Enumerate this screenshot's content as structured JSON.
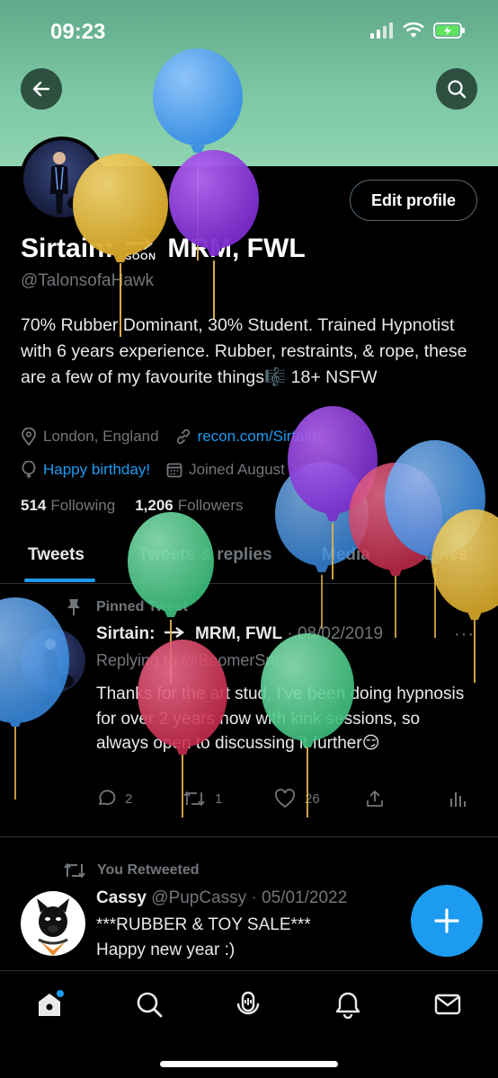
{
  "status_bar": {
    "time": "09:23"
  },
  "profile": {
    "display_name_part1": "Sirtain:",
    "soon_text": "SOON",
    "display_name_part2": "MRM, FWL",
    "handle": "@TalonsofaHawk",
    "bio": "70% Rubber Dominant, 30% Student. Trained Hypnotist with 6 years experience. Rubber, restraints, & rope, these are a few of my favourite things🎼 18+ NSFW",
    "location": "London, England",
    "website": "recon.com/Sirtain",
    "birthday": "Happy birthday!",
    "joined": "Joined August 2009",
    "following_count": "514",
    "following_label": "Following",
    "followers_count": "1,206",
    "followers_label": "Followers",
    "edit_profile_label": "Edit profile"
  },
  "tabs": [
    "Tweets",
    "Tweets & replies",
    "Media",
    "Likes"
  ],
  "pinned_tweet": {
    "pinned_label": "Pinned Tweet",
    "author_name": "Sirtain:",
    "author_suffix": "MRM, FWL",
    "date": "· 08/02/2019",
    "replying_to": "Replying to @BoomerSm",
    "text": "Thanks for the art stud, I've been doing hypnosis for over 2 years now with kink sessions, so always open to discussing it further😏",
    "replies": "2",
    "retweets": "1",
    "likes": "26"
  },
  "retweet": {
    "label": "You Retweeted",
    "author_name": "Cassy",
    "handle_date": "@PupCassy · 05/01/2022",
    "line1": "***RUBBER & TOY SALE***",
    "line2": "Happy new year :)"
  },
  "nav": [
    "home-icon",
    "search-icon",
    "spaces-icon",
    "notifications-icon",
    "messages-icon"
  ],
  "colors": {
    "accent": "#1d9bf0",
    "banner": "#7cc7a4",
    "background": "#000000"
  }
}
